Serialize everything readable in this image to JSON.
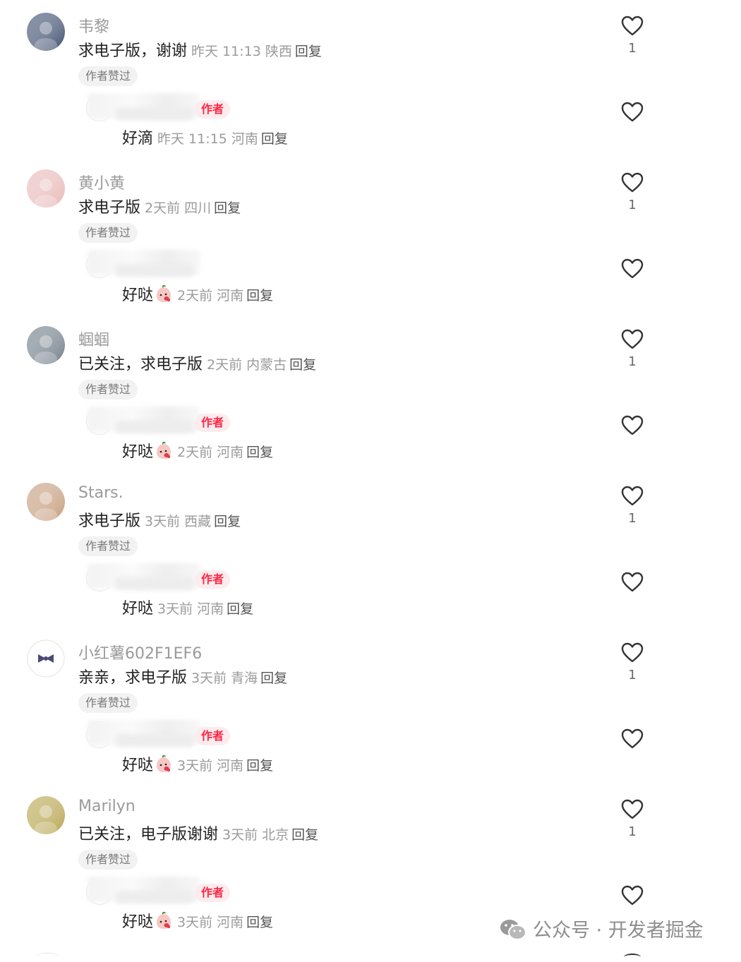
{
  "labels": {
    "reply": "回复",
    "liked_by_author": "作者赞过",
    "author_tag": "作者"
  },
  "comments": [
    {
      "avatar": "user-avatar-photo",
      "avatar_color": "#3a4a6b",
      "username": "韦黎",
      "text": "求电子版，谢谢",
      "time": "昨天 11:13",
      "location": "陕西",
      "likes": "1",
      "reply": {
        "text": "好滴",
        "emoji": false,
        "time": "昨天 11:15",
        "location": "河南",
        "author_tag_visible": true
      }
    },
    {
      "avatar": "hello-kitty-avatar",
      "avatar_color": "#e8b6b6",
      "username": "黄小黄",
      "text": "求电子版",
      "time": "2天前",
      "location": "四川",
      "likes": "1",
      "reply": {
        "text": "好哒",
        "emoji": true,
        "time": "2天前",
        "location": "河南",
        "author_tag_visible": false
      }
    },
    {
      "avatar": "sunset-landscape-avatar",
      "avatar_color": "#6d7a86",
      "username": "蝈蝈",
      "text": "已关注，求电子版",
      "time": "2天前",
      "location": "内蒙古",
      "likes": "1",
      "reply": {
        "text": "好哒",
        "emoji": true,
        "time": "2天前",
        "location": "河南",
        "author_tag_visible": true
      }
    },
    {
      "avatar": "person-selfie-avatar",
      "avatar_color": "#c49a7a",
      "username": "Stars.",
      "text": "求电子版",
      "time": "3天前",
      "location": "西藏",
      "likes": "1",
      "reply": {
        "text": "好哒",
        "emoji": false,
        "time": "3天前",
        "location": "河南",
        "author_tag_visible": true
      }
    },
    {
      "avatar": "bow-icon-avatar",
      "avatar_color": "#ffffff",
      "username": "小红薯602F1EF6",
      "text": "亲亲，求电子版",
      "time": "3天前",
      "location": "青海",
      "likes": "1",
      "reply": {
        "text": "好哒",
        "emoji": true,
        "time": "3天前",
        "location": "河南",
        "author_tag_visible": true
      }
    },
    {
      "avatar": "food-photo-avatar",
      "avatar_color": "#b5a24a",
      "username": "Marilyn",
      "text": "已关注，电子版谢谢",
      "time": "3天前",
      "location": "北京",
      "likes": "1",
      "reply": {
        "text": "好哒",
        "emoji": true,
        "time": "3天前",
        "location": "河南",
        "author_tag_visible": true
      }
    }
  ],
  "icons": {
    "like": "heart-outline-icon",
    "emoji": "peach-face-emoji",
    "watermark": "wechat-icon"
  },
  "colors": {
    "author_tag_text": "#ff2442",
    "author_tag_bg": "#fdecee",
    "meta_text": "#9b9b9b",
    "badge_bg": "#f2f2f2"
  },
  "watermark": {
    "text": "公众号 · 开发者掘金"
  }
}
